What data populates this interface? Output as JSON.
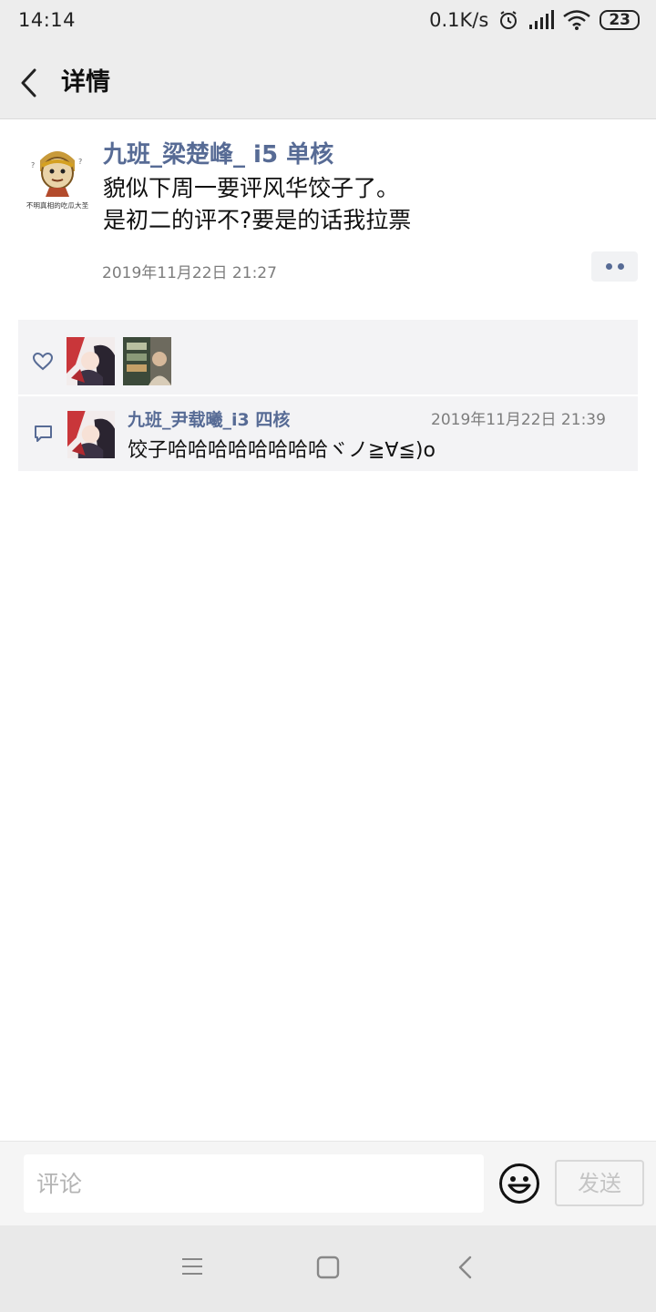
{
  "status_bar": {
    "time": "14:14",
    "network_speed": "0.1K/s",
    "battery": "23",
    "icons": [
      "alarm-icon",
      "signal-icon",
      "wifi-icon",
      "battery-icon"
    ]
  },
  "header": {
    "title": "详情",
    "back_icon": "back-chevron-icon"
  },
  "post": {
    "author": "九班_梁楚峰_ i5 单核",
    "avatar_caption": "不明真相的吃瓜大圣",
    "content": "貌似下周一要评风华饺子了。\n是初二的评不?要是的话我拉票",
    "timestamp": "2019年11月22日 21:27"
  },
  "likes": {
    "icon": "heart-icon",
    "count": 2
  },
  "comments": [
    {
      "name": "九班_尹载曦_i3 四核",
      "time": "2019年11月22日 21:39",
      "text": "饺子哈哈哈哈哈哈哈哈ヾノ≧∀≦)o"
    }
  ],
  "input_bar": {
    "placeholder": "评论",
    "send_label": "发送"
  },
  "colors": {
    "name_link": "#576b95",
    "timestamp": "#7d7d7d",
    "bar_bg": "#ededed",
    "interact_bg": "#f3f3f5"
  }
}
